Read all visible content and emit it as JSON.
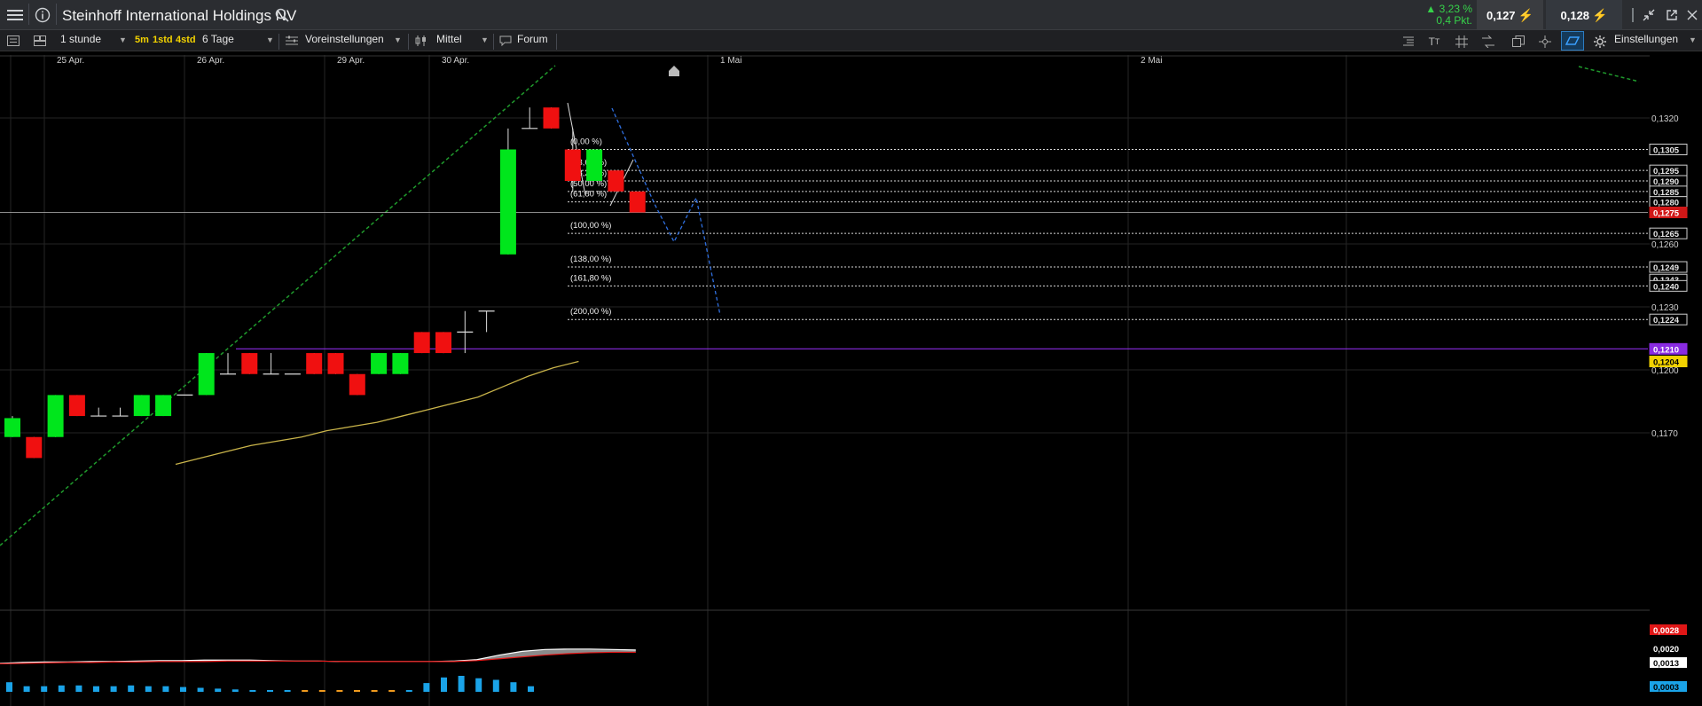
{
  "header": {
    "instrument_title": "Steinhoff International Holdings NV",
    "change_percent": "3,23 %",
    "change_points": "0,4 Pkt.",
    "bid": "0,127",
    "ask": "0,128"
  },
  "toolbar": {
    "interval": "1 stunde",
    "quick_intervals": [
      "5m",
      "1std",
      "4std"
    ],
    "range": "6 Tage",
    "presets_label": "Voreinstellungen",
    "style_label": "Mittel",
    "forum_label": "Forum",
    "settings_label": "Einstellungen"
  },
  "colors": {
    "up_candle": "#00e61c",
    "down_candle": "#f01010",
    "ma_line": "#c9b44a",
    "trend_line": "#1f9a2c",
    "horizontal_line": "#8a2be2",
    "projection_line": "#2f6fe0",
    "highlight_price": "#d01717",
    "marker_price": "#f2d200"
  },
  "chart_data": {
    "type": "candlestick",
    "x_labels": [
      "25 Apr.",
      "26 Apr.",
      "29 Apr.",
      "30 Apr.",
      "1 Mai",
      "2 Mai"
    ],
    "y_tick_labels": [
      "0,1320",
      "0,1260",
      "0,1230",
      "0,1200",
      "0,1170"
    ],
    "price_labels": [
      "0,1305",
      "0,1295",
      "0,1290",
      "0,1285",
      "0,1280",
      "0,1275",
      "0,1265",
      "0,1249",
      "0,1243",
      "0,1240",
      "0,1224",
      "0,1210",
      "0,1204"
    ],
    "fib_labels": [
      "(0,00 %)",
      "(23,60 %)",
      "(38,20 %)",
      "(50,00 %)",
      "(61,80 %)",
      "(100,00 %)",
      "(138,00 %)",
      "(161,80 %)",
      "(200,00 %)"
    ],
    "fib_values": [
      0.1305,
      0.1295,
      0.129,
      0.1285,
      0.128,
      0.1265,
      0.1249,
      0.124,
      0.1224
    ],
    "candles": [
      {
        "o": 0.1168,
        "h": 0.1178,
        "l": 0.1168,
        "c": 0.1177
      },
      {
        "o": 0.1168,
        "h": 0.1168,
        "l": 0.1158,
        "c": 0.1158
      },
      {
        "o": 0.1168,
        "h": 0.1188,
        "l": 0.1168,
        "c": 0.1188
      },
      {
        "o": 0.1188,
        "h": 0.1188,
        "l": 0.1178,
        "c": 0.1178
      },
      {
        "o": 0.1178,
        "h": 0.1182,
        "l": 0.1178,
        "c": 0.1178
      },
      {
        "o": 0.1178,
        "h": 0.1182,
        "l": 0.1178,
        "c": 0.1178
      },
      {
        "o": 0.1178,
        "h": 0.1188,
        "l": 0.1178,
        "c": 0.1188
      },
      {
        "o": 0.1178,
        "h": 0.1188,
        "l": 0.1178,
        "c": 0.1188
      },
      {
        "o": 0.1188,
        "h": 0.1188,
        "l": 0.1188,
        "c": 0.1188
      },
      {
        "o": 0.1188,
        "h": 0.1208,
        "l": 0.1188,
        "c": 0.1208
      },
      {
        "o": 0.1198,
        "h": 0.1208,
        "l": 0.1198,
        "c": 0.1198
      },
      {
        "o": 0.1208,
        "h": 0.1208,
        "l": 0.1198,
        "c": 0.1198
      },
      {
        "o": 0.1198,
        "h": 0.1208,
        "l": 0.1198,
        "c": 0.1198
      },
      {
        "o": 0.1198,
        "h": 0.1198,
        "l": 0.1198,
        "c": 0.1198
      },
      {
        "o": 0.1208,
        "h": 0.1208,
        "l": 0.1198,
        "c": 0.1198
      },
      {
        "o": 0.1208,
        "h": 0.1208,
        "l": 0.1198,
        "c": 0.1198
      },
      {
        "o": 0.1198,
        "h": 0.1198,
        "l": 0.1188,
        "c": 0.1188
      },
      {
        "o": 0.1198,
        "h": 0.1208,
        "l": 0.1198,
        "c": 0.1208
      },
      {
        "o": 0.1198,
        "h": 0.1208,
        "l": 0.1198,
        "c": 0.1208
      },
      {
        "o": 0.1218,
        "h": 0.1218,
        "l": 0.1208,
        "c": 0.1208
      },
      {
        "o": 0.1218,
        "h": 0.1218,
        "l": 0.1208,
        "c": 0.1208
      },
      {
        "o": 0.1218,
        "h": 0.1228,
        "l": 0.1208,
        "c": 0.1218
      },
      {
        "o": 0.1228,
        "h": 0.1228,
        "l": 0.1218,
        "c": 0.1228
      },
      {
        "o": 0.1255,
        "h": 0.1315,
        "l": 0.1255,
        "c": 0.1305
      },
      {
        "o": 0.1315,
        "h": 0.1325,
        "l": 0.1315,
        "c": 0.1315
      },
      {
        "o": 0.1325,
        "h": 0.1325,
        "l": 0.1315,
        "c": 0.1315
      },
      {
        "o": 0.1305,
        "h": 0.1315,
        "l": 0.1285,
        "c": 0.129
      },
      {
        "o": 0.129,
        "h": 0.1305,
        "l": 0.129,
        "c": 0.1305
      },
      {
        "o": 0.1295,
        "h": 0.1295,
        "l": 0.1285,
        "c": 0.1285
      },
      {
        "o": 0.1285,
        "h": 0.1285,
        "l": 0.1275,
        "c": 0.1275
      }
    ],
    "moving_average": [
      0.1155,
      0.1158,
      0.1161,
      0.1164,
      0.1166,
      0.1168,
      0.1171,
      0.1173,
      0.1175,
      0.1178,
      0.1181,
      0.1184,
      0.1187,
      0.1192,
      0.1197,
      0.1201,
      0.1204
    ],
    "indicator_labels": [
      "0,0028",
      "0,0020",
      "0,0013",
      "0,0003"
    ]
  }
}
